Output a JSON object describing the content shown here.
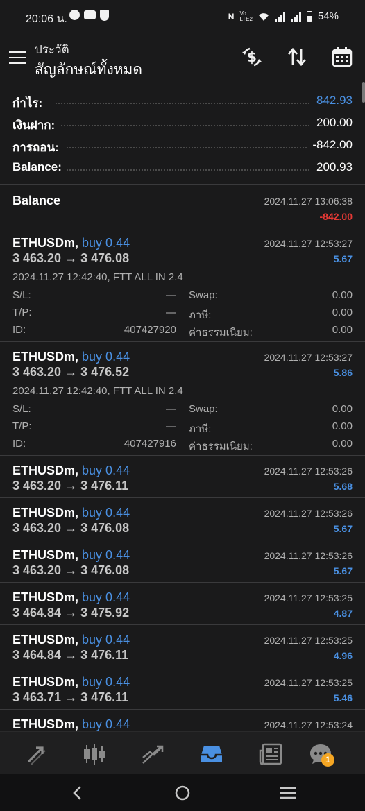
{
  "status_bar": {
    "time": "20:06 น.",
    "battery": "54%",
    "network": "Vo LTE2"
  },
  "header": {
    "subtitle": "ประวัติ",
    "title": "สัญลักษณ์ทั้งหมด"
  },
  "summary": [
    {
      "label": "กำไร:",
      "value": "842.93",
      "color": "#4a90e2"
    },
    {
      "label": "เงินฝาก:",
      "value": "200.00"
    },
    {
      "label": "การถอน:",
      "value": "-842.00"
    },
    {
      "label": "Balance:",
      "value": "200.93"
    }
  ],
  "balance_entry": {
    "title": "Balance",
    "time": "2024.11.27 13:06:38",
    "amount": "-842.00"
  },
  "deals": [
    {
      "symbol": "ETHUSDm,",
      "side": "buy 0.44",
      "open_price": "3 463.20",
      "arrow": "→",
      "close_price": "3 476.08",
      "time": "2024.11.27 12:53:27",
      "profit": "5.67",
      "details": {
        "open_line": "2024.11.27 12:42:40, FTT ALL IN 2.4",
        "sl_label": "S/L:",
        "sl_value": "—",
        "swap_label": "Swap:",
        "swap_value": "0.00",
        "tp_label": "T/P:",
        "tp_value": "—",
        "tax_label": "ภาษี:",
        "tax_value": "0.00",
        "id_label": "ID:",
        "id_value": "407427920",
        "fee_label": "ค่าธรรมเนียม:",
        "fee_value": "0.00"
      }
    },
    {
      "symbol": "ETHUSDm,",
      "side": "buy 0.44",
      "open_price": "3 463.20",
      "arrow": "→",
      "close_price": "3 476.52",
      "time": "2024.11.27 12:53:27",
      "profit": "5.86",
      "details": {
        "open_line": "2024.11.27 12:42:40, FTT ALL IN 2.4",
        "sl_label": "S/L:",
        "sl_value": "—",
        "swap_label": "Swap:",
        "swap_value": "0.00",
        "tp_label": "T/P:",
        "tp_value": "—",
        "tax_label": "ภาษี:",
        "tax_value": "0.00",
        "id_label": "ID:",
        "id_value": "407427916",
        "fee_label": "ค่าธรรมเนียม:",
        "fee_value": "0.00"
      }
    },
    {
      "symbol": "ETHUSDm,",
      "side": "buy 0.44",
      "open_price": "3 463.20",
      "arrow": "→",
      "close_price": "3 476.11",
      "time": "2024.11.27 12:53:26",
      "profit": "5.68"
    },
    {
      "symbol": "ETHUSDm,",
      "side": "buy 0.44",
      "open_price": "3 463.20",
      "arrow": "→",
      "close_price": "3 476.08",
      "time": "2024.11.27 12:53:26",
      "profit": "5.67"
    },
    {
      "symbol": "ETHUSDm,",
      "side": "buy 0.44",
      "open_price": "3 463.20",
      "arrow": "→",
      "close_price": "3 476.08",
      "time": "2024.11.27 12:53:26",
      "profit": "5.67"
    },
    {
      "symbol": "ETHUSDm,",
      "side": "buy 0.44",
      "open_price": "3 464.84",
      "arrow": "→",
      "close_price": "3 475.92",
      "time": "2024.11.27 12:53:25",
      "profit": "4.87"
    },
    {
      "symbol": "ETHUSDm,",
      "side": "buy 0.44",
      "open_price": "3 464.84",
      "arrow": "→",
      "close_price": "3 476.11",
      "time": "2024.11.27 12:53:25",
      "profit": "4.96"
    },
    {
      "symbol": "ETHUSDm,",
      "side": "buy 0.44",
      "open_price": "3 463.71",
      "arrow": "→",
      "close_price": "3 476.11",
      "time": "2024.11.27 12:53:25",
      "profit": "5.46"
    },
    {
      "symbol": "ETHUSDm,",
      "side": "buy 0.44",
      "time": "2024.11.27 12:53:24"
    }
  ],
  "bottom_nav": {
    "items": [
      "trade-icon",
      "chart-candles-icon",
      "trend-icon",
      "history-inbox-icon",
      "news-icon",
      "chat-icon"
    ],
    "active": "history-inbox-icon",
    "chat_badge": "1",
    "active_color": "#4a90e2"
  }
}
